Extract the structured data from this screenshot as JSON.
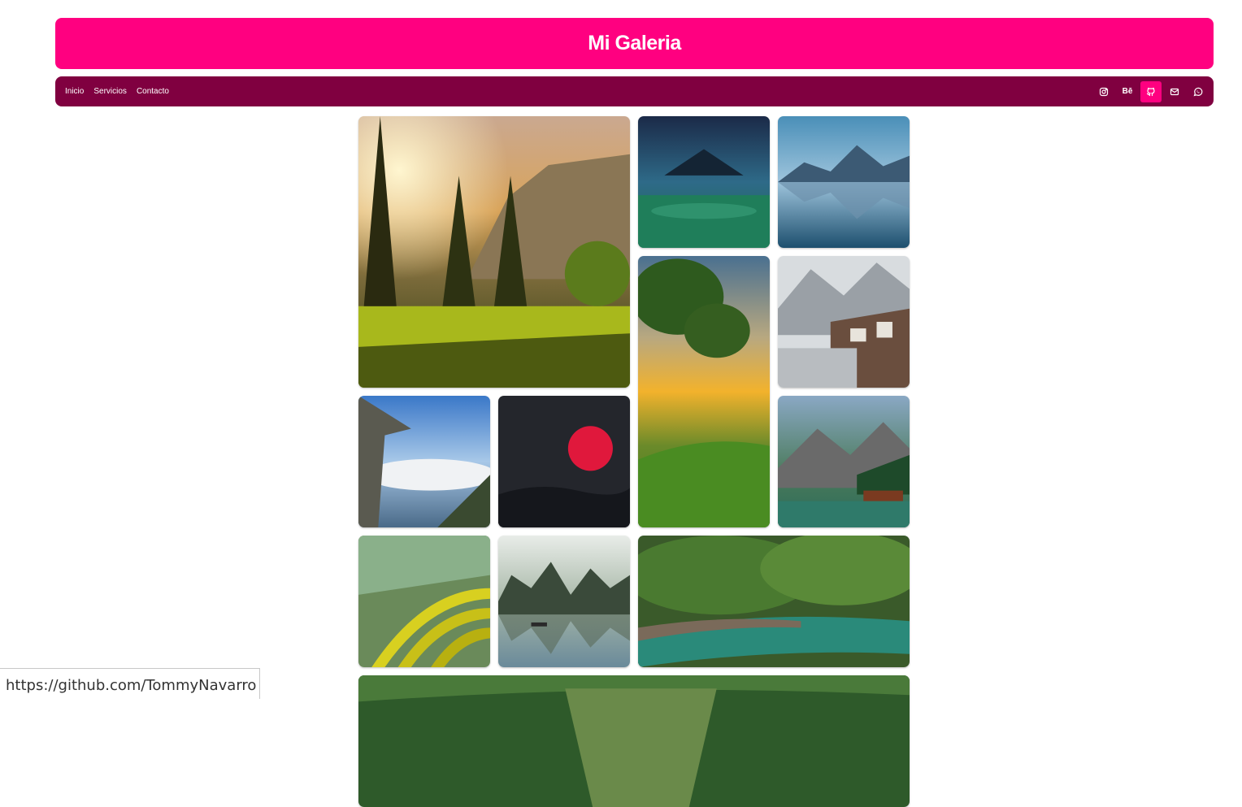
{
  "header": {
    "title": "Mi Galeria"
  },
  "nav": {
    "links": [
      "Inicio",
      "Servicios",
      "Contacto"
    ]
  },
  "social": {
    "behance_label": "Bē",
    "icons": [
      "instagram-icon",
      "behance-icon",
      "github-icon",
      "mail-icon",
      "whatsapp-icon"
    ],
    "active": "github-icon"
  },
  "gallery": {
    "images": [
      "forest-meadow-sunrise",
      "mountain-night-sky",
      "mountain-lake-reflection",
      "golden-sunset-tree",
      "snowy-alpine-village",
      "cliff-above-clouds",
      "red-sun-dark-sky",
      "lake-with-boathouse",
      "rice-terraces",
      "karst-river-boat",
      "forest-stream",
      "green-valley-road"
    ]
  },
  "status_bar": {
    "url": "https://github.com/TommyNavarro"
  },
  "colors": {
    "header_bg": "#ff0080",
    "nav_bg": "#800040",
    "active_icon_bg": "#ff0080"
  }
}
